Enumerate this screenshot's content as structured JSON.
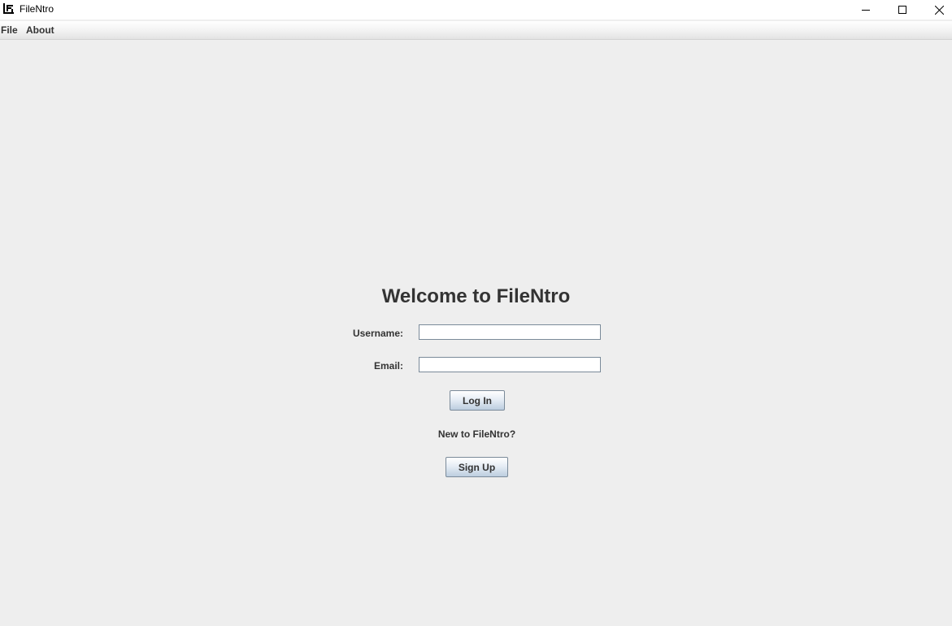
{
  "window": {
    "title": "FileNtro",
    "controls": {
      "minimize": "minimize-icon",
      "maximize": "maximize-icon",
      "close": "close-icon"
    }
  },
  "menu": {
    "items": [
      {
        "label": "File"
      },
      {
        "label": "About"
      }
    ]
  },
  "login": {
    "heading": "Welcome to FileNtro",
    "username_label": "Username:",
    "username_value": "",
    "email_label": "Email:",
    "email_value": "",
    "login_button": "Log In",
    "new_user_text": "New to FileNtro?",
    "signup_button": "Sign Up"
  },
  "colors": {
    "background": "#eeeeee",
    "titlebar": "#ffffff",
    "text": "#333333",
    "button_border": "#7a8a99"
  }
}
